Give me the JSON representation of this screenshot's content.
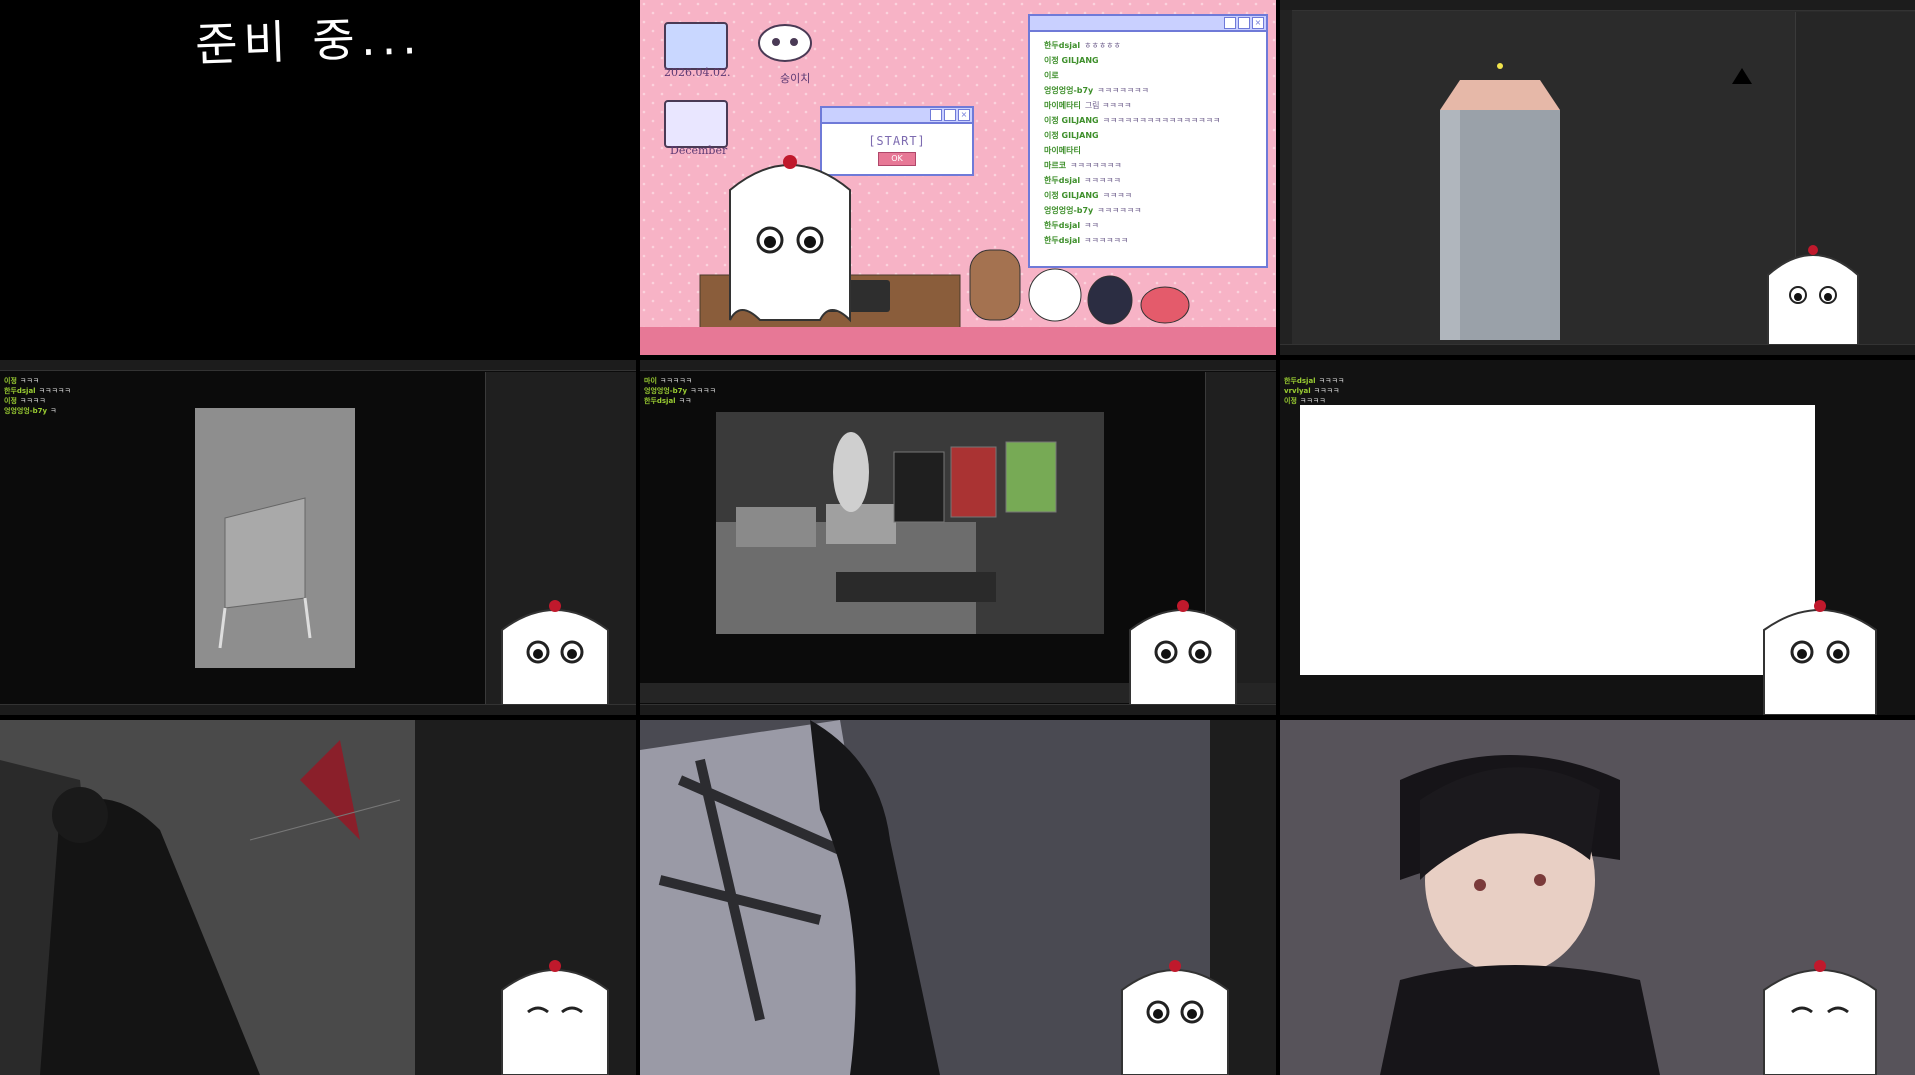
{
  "tile1": {
    "text": "준비 중..."
  },
  "tile2": {
    "icons": [
      {
        "label": "2026.04.02.",
        "icon": "wing-folder-icon"
      },
      {
        "label": "숭이치",
        "icon": "puppy-icon"
      },
      {
        "label": "December",
        "icon": "paw-folder-icon"
      }
    ],
    "start_window": {
      "title": "",
      "text": "[START]",
      "ok": "OK"
    },
    "chat": [
      {
        "name": "한두dsjal",
        "msg": "ㅎㅎㅎㅎㅎ",
        "color": "#3e8f2b"
      },
      {
        "name": "이정 GILJANG",
        "msg": "",
        "color": "#3e8f2b"
      },
      {
        "name": "이로",
        "msg": "",
        "color": "#3e8f2b"
      },
      {
        "name": "엉엉엉엉-b7y",
        "msg": "ㅋㅋㅋㅋㅋㅋㅋ",
        "color": "#3e8f2b"
      },
      {
        "name": "마이메타티",
        "msg": "그림 ㅋㅋㅋㅋ",
        "color": "#3e8f2b"
      },
      {
        "name": "이정 GILJANG",
        "msg": "ㅋㅋㅋㅋㅋㅋㅋㅋㅋㅋㅋㅋㅋㅋㅋㅋ",
        "color": "#3e8f2b"
      },
      {
        "name": "이정 GILJANG",
        "msg": "",
        "color": "#3e8f2b"
      },
      {
        "name": "마이메타티",
        "msg": "",
        "color": "#3e8f2b"
      },
      {
        "name": "마르코",
        "msg": "ㅋㅋㅋㅋㅋㅋㅋ",
        "color": "#3e8f2b"
      },
      {
        "name": "한두dsjal",
        "msg": "ㅋㅋㅋㅋㅋ",
        "color": "#3e8f2b"
      },
      {
        "name": "이정 GILJANG",
        "msg": "ㅋㅋㅋㅋ",
        "color": "#3e8f2b"
      },
      {
        "name": "엉엉엉엉-b7y",
        "msg": "ㅋㅋㅋㅋㅋㅋ",
        "color": "#3e8f2b"
      },
      {
        "name": "한두dsjal",
        "msg": "ㅋㅋ",
        "color": "#3e8f2b"
      },
      {
        "name": "한두dsjal",
        "msg": "ㅋㅋㅋㅋㅋㅋ",
        "color": "#3e8f2b"
      }
    ]
  },
  "tile5_chat": [
    {
      "name": "마이",
      "msg": "ㅋㅋㅋㅋㅋ"
    },
    {
      "name": "엉엉엉엉-b7y",
      "msg": "ㅋㅋㅋㅋ"
    },
    {
      "name": "한두dsjal",
      "msg": "ㅋㅋ"
    }
  ],
  "tile4_chat": [
    {
      "name": "이정",
      "msg": "ㅋㅋㅋ"
    },
    {
      "name": "한두dsjal",
      "msg": "ㅋㅋㅋㅋㅋ"
    },
    {
      "name": "이정",
      "msg": "ㅋㅋㅋㅋ"
    },
    {
      "name": "엉엉엉엉-b7y",
      "msg": "ㅋ"
    }
  ],
  "tile6_chat": [
    {
      "name": "한두dsjal",
      "msg": "ㅋㅋㅋㅋ"
    },
    {
      "name": "vrvlyal",
      "msg": "ㅋㅋㅋㅋ"
    },
    {
      "name": "이정",
      "msg": "ㅋㅋㅋㅋ"
    }
  ],
  "colors": {
    "pink": "#f7b3c6",
    "dark": "#000000",
    "chat_green": "#9acd32"
  }
}
